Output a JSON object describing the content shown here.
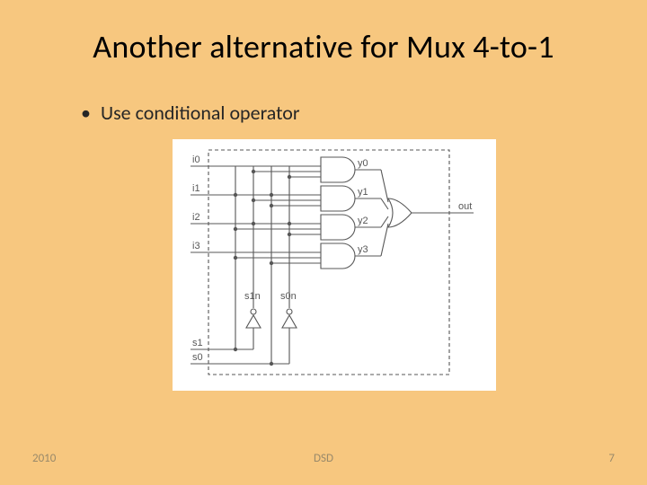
{
  "title": "Another alternative for Mux 4-to-1",
  "bullet": "Use conditional operator",
  "footer": {
    "year": "2010",
    "course": "DSD",
    "page": "7"
  },
  "diagram": {
    "inputs": [
      "i0",
      "i1",
      "i2",
      "i3"
    ],
    "selects": [
      "s1",
      "s0"
    ],
    "select_inverted": [
      "s1n",
      "s0n"
    ],
    "and_outputs": [
      "y0",
      "y1",
      "y2",
      "y3"
    ],
    "output": "out"
  }
}
